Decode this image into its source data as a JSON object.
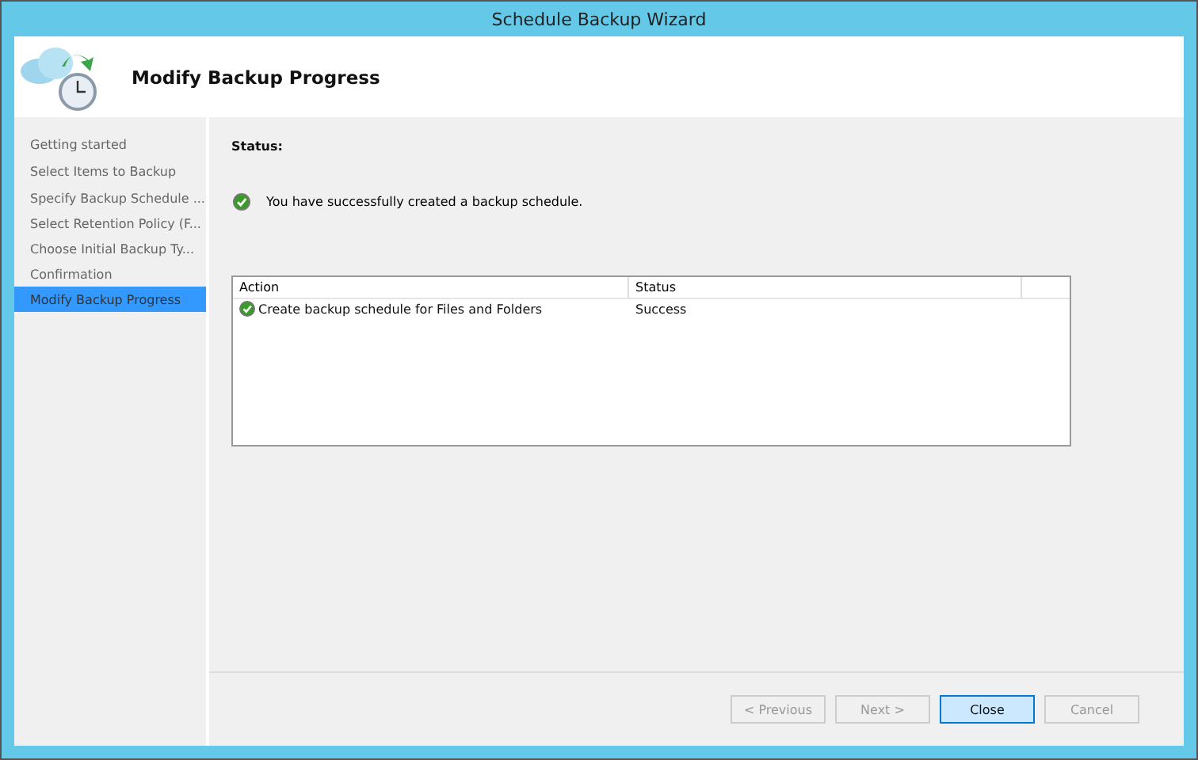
{
  "window": {
    "title": "Schedule Backup Wizard"
  },
  "header": {
    "title": "Modify Backup Progress"
  },
  "steps": [
    {
      "label": "Getting started",
      "selected": false
    },
    {
      "label": "Select Items to Backup",
      "selected": false
    },
    {
      "label": "Specify Backup Schedule ...",
      "selected": false
    },
    {
      "label": "Select Retention Policy (F...",
      "selected": false
    },
    {
      "label": "Choose Initial Backup Ty...",
      "selected": false
    },
    {
      "label": "Confirmation",
      "selected": false
    },
    {
      "label": "Modify Backup Progress",
      "selected": true
    }
  ],
  "status": {
    "label": "Status:",
    "message": "You have successfully created a backup schedule."
  },
  "table": {
    "columns": [
      "Action",
      "Status"
    ],
    "rows": [
      {
        "action": "Create backup schedule for Files and Folders",
        "status": "Success"
      }
    ]
  },
  "buttons": [
    {
      "label": "< Previous",
      "disabled": true,
      "default": false
    },
    {
      "label": "Next >",
      "disabled": true,
      "default": false
    },
    {
      "label": "Close",
      "disabled": false,
      "default": true
    },
    {
      "label": "Cancel",
      "disabled": true,
      "default": false
    }
  ]
}
